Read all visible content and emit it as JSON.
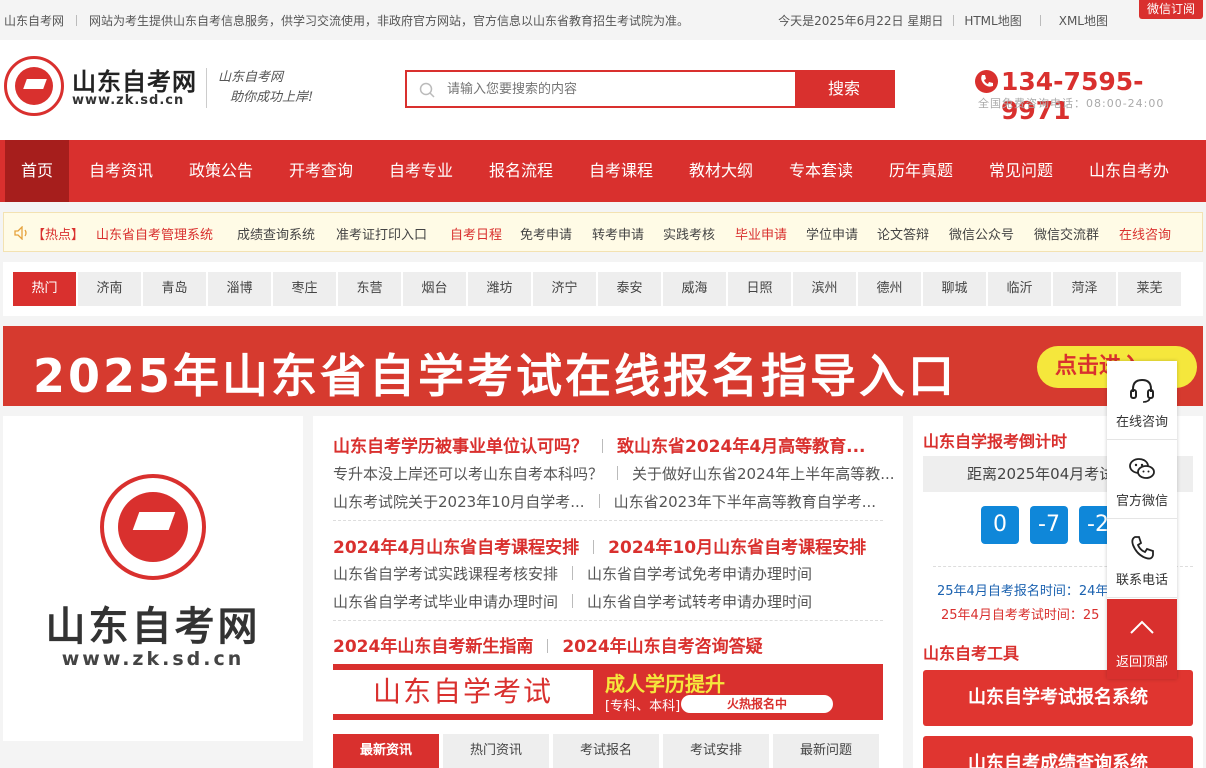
{
  "topbar": {
    "site": "山东自考网",
    "notice": "网站为考生提供山东自考信息服务，供学习交流使用，非政府官方网站，官方信息以山东省教育招生考试院为准。",
    "date": "今天是2025年6月22日 星期日",
    "html_map": "HTML地图",
    "xml_map": "XML地图",
    "wechat_sub": "微信订阅"
  },
  "header": {
    "logo_name": "山东自考网",
    "logo_url": "www.zk.sd.cn",
    "slogan_line1": "山东自考网",
    "slogan_line2": "助你成功上岸!",
    "search_placeholder": "请输入您要搜索的内容",
    "search_button": "搜索",
    "phone": "134-7595-9971",
    "phone_sub": "全国免费咨询电话：08:00-24:00"
  },
  "nav": [
    "首页",
    "自考资讯",
    "政策公告",
    "开考查询",
    "自考专业",
    "报名流程",
    "自考课程",
    "教材大纲",
    "专本套读",
    "历年真题",
    "常见问题",
    "山东自考办"
  ],
  "hotbar": {
    "label": "【热点】",
    "items": [
      {
        "text": "山东省自考管理系统",
        "red": true
      },
      {
        "text": "成绩查询系统",
        "red": false
      },
      {
        "text": "准考证打印入口",
        "red": false
      },
      {
        "text": "自考日程",
        "red": true
      },
      {
        "text": "免考申请",
        "red": false
      },
      {
        "text": "转考申请",
        "red": false
      },
      {
        "text": "实践考核",
        "red": false
      },
      {
        "text": "毕业申请",
        "red": true
      },
      {
        "text": "学位申请",
        "red": false
      },
      {
        "text": "论文答辩",
        "red": false
      },
      {
        "text": "微信公众号",
        "red": false
      },
      {
        "text": "微信交流群",
        "red": false
      },
      {
        "text": "在线咨询",
        "red": true
      }
    ]
  },
  "cities": [
    "热门",
    "济南",
    "青岛",
    "淄博",
    "枣庄",
    "东营",
    "烟台",
    "潍坊",
    "济宁",
    "泰安",
    "威海",
    "日照",
    "滨州",
    "德州",
    "聊城",
    "临沂",
    "菏泽",
    "莱芜"
  ],
  "banner": {
    "title": "2025年山东省自学考试在线报名指导入口",
    "button": "点击进入"
  },
  "left_logo": {
    "name": "山东自考网",
    "url": "www.zk.sd.cn"
  },
  "middle": {
    "block1": {
      "headlines": [
        "山东自考学历被事业单位认可吗？",
        "致山东省2024年4月高等教育..."
      ],
      "rows": [
        [
          "专升本没上岸还可以考山东自考本科吗？",
          "关于做好山东省2024年上半年高等教..."
        ],
        [
          "山东考试院关于2023年10月自学考...",
          "山东省2023年下半年高等教育自学考..."
        ]
      ]
    },
    "block2": {
      "headlines": [
        "2024年4月山东省自考课程安排",
        "2024年10月山东省自考课程安排"
      ],
      "rows": [
        [
          "山东省自学考试实践课程考核安排",
          "山东省自学考试免考申请办理时间"
        ],
        [
          "山东省自学考试毕业申请办理时间",
          "山东省自学考试转考申请办理时间"
        ]
      ]
    },
    "block3": {
      "headlines": [
        "2024年山东自考新生指南",
        "2024年山东自考咨询答疑"
      ]
    },
    "mini_banner": {
      "title": "山东自学考试",
      "line2": "成人学历提升",
      "line3": "[专科、本科]",
      "pill": "火热报名中"
    },
    "tabs": [
      "最新资讯",
      "热门资讯",
      "考试报名",
      "考试安排",
      "最新问题"
    ]
  },
  "right": {
    "countdown_title": "山东自学报考倒计时",
    "countdown_bar": "距离2025年04月考试",
    "counts": [
      "0",
      "-7",
      "-2"
    ],
    "info1": "25年4月自考报名时间：24年",
    "info2": "25年4月自考考试时间：25",
    "tools_title": "山东自考工具",
    "btn1": "山东自学考试报名系统",
    "btn2": "山东自考成绩查询系统"
  },
  "float": {
    "online": "在线咨询",
    "wechat": "官方微信",
    "phone": "联系电话",
    "top": "返回顶部"
  }
}
